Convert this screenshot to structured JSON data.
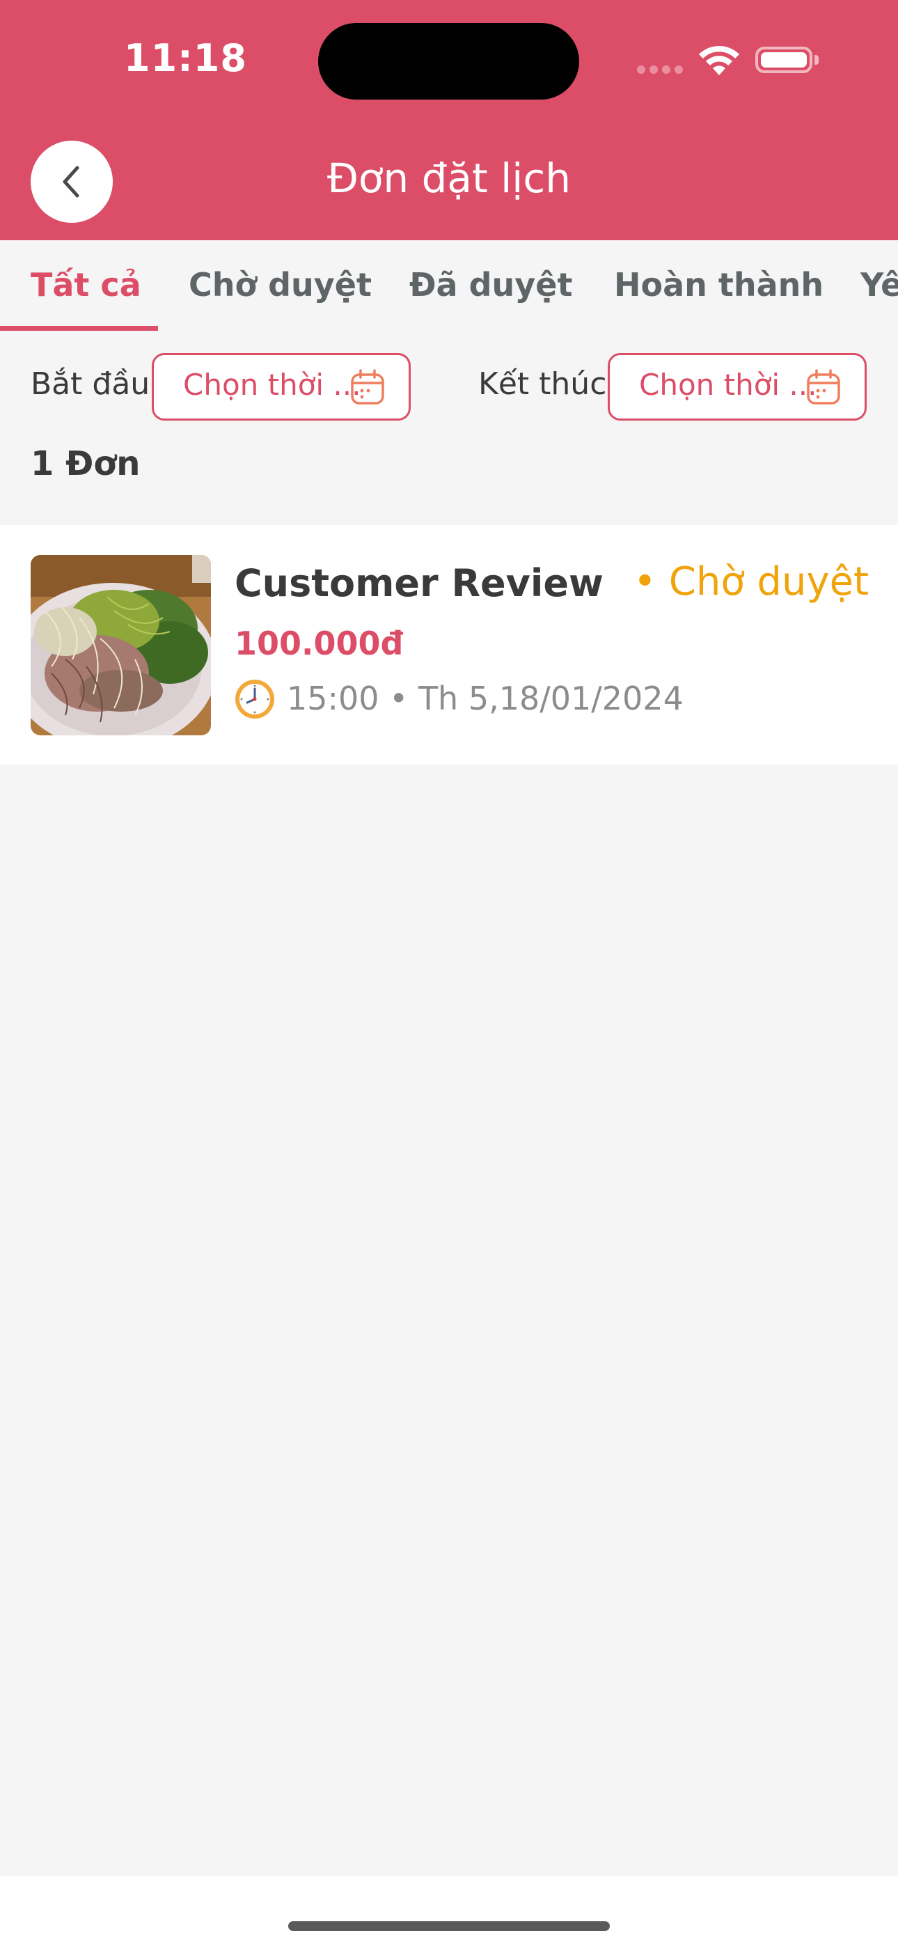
{
  "status_bar": {
    "time": "11:18"
  },
  "header": {
    "title": "Đơn đặt lịch",
    "back_icon": "chevron-left-icon"
  },
  "tabs": [
    {
      "label": "Tất cả",
      "active": true
    },
    {
      "label": "Chờ duyệt",
      "active": false
    },
    {
      "label": "Đã duyệt",
      "active": false
    },
    {
      "label": "Hoàn thành",
      "active": false
    },
    {
      "label": "Yê",
      "active": false
    }
  ],
  "filters": {
    "start_label": "Bắt đầu:",
    "start_placeholder": "Chọn thời ...",
    "end_label": "Kết thúc:",
    "end_placeholder": "Chọn thời ...",
    "calendar_icon": "calendar-icon"
  },
  "order_count": "1 Đơn",
  "orders": [
    {
      "title": "Customer Review",
      "status": "• Chờ duyệt",
      "price": "100.000đ",
      "datetime": "15:00 • Th 5,18/01/2024",
      "time_icon": "clock-icon"
    }
  ],
  "colors": {
    "primary": "#DC4E67",
    "pending": "#F0A30A",
    "background": "#f5f5f5"
  }
}
